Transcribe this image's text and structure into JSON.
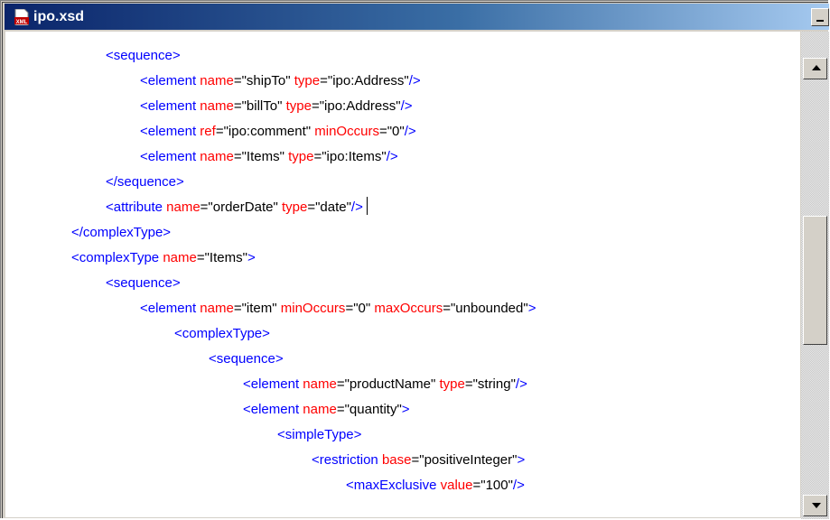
{
  "window": {
    "title": "ipo.xsd",
    "icon": "xml-file-icon",
    "icon_text": "XML",
    "colors": {
      "titlebar_start": "#0a246a",
      "titlebar_end": "#a6caf0",
      "tag": "#0000ff",
      "attribute": "#ff0000",
      "value": "#000000"
    }
  },
  "code": {
    "lines": [
      {
        "indent": 3,
        "parts": [
          [
            "t",
            "<sequence>"
          ]
        ]
      },
      {
        "indent": 4,
        "parts": [
          [
            "t",
            "<element "
          ],
          [
            "a",
            "name"
          ],
          [
            "v",
            "=\"shipTo\" "
          ],
          [
            "a",
            "type"
          ],
          [
            "v",
            "=\"ipo:Address\""
          ],
          [
            "t",
            "/>"
          ]
        ]
      },
      {
        "indent": 4,
        "parts": [
          [
            "t",
            "<element "
          ],
          [
            "a",
            "name"
          ],
          [
            "v",
            "=\"billTo\" "
          ],
          [
            "a",
            "type"
          ],
          [
            "v",
            "=\"ipo:Address\""
          ],
          [
            "t",
            "/>"
          ]
        ]
      },
      {
        "indent": 4,
        "parts": [
          [
            "t",
            "<element "
          ],
          [
            "a",
            "ref"
          ],
          [
            "v",
            "=\"ipo:comment\" "
          ],
          [
            "a",
            "minOccurs"
          ],
          [
            "v",
            "=\"0\""
          ],
          [
            "t",
            "/>"
          ]
        ]
      },
      {
        "indent": 4,
        "parts": [
          [
            "t",
            "<element "
          ],
          [
            "a",
            "name"
          ],
          [
            "v",
            "=\"Items\" "
          ],
          [
            "a",
            "type"
          ],
          [
            "v",
            "=\"ipo:Items\""
          ],
          [
            "t",
            "/>"
          ]
        ]
      },
      {
        "indent": 3,
        "parts": [
          [
            "t",
            "</sequence>"
          ]
        ]
      },
      {
        "indent": 3,
        "parts": [
          [
            "t",
            "<attribute "
          ],
          [
            "a",
            "name"
          ],
          [
            "v",
            "=\"orderDate\" "
          ],
          [
            "a",
            "type"
          ],
          [
            "v",
            "=\"date\""
          ],
          [
            "t",
            "/>"
          ]
        ],
        "caret": true
      },
      {
        "indent": 2,
        "parts": [
          [
            "t",
            "</complexType>"
          ]
        ]
      },
      {
        "indent": 2,
        "parts": [
          [
            "t",
            "<complexType "
          ],
          [
            "a",
            "name"
          ],
          [
            "v",
            "=\"Items\""
          ],
          [
            "t",
            ">"
          ]
        ]
      },
      {
        "indent": 3,
        "parts": [
          [
            "t",
            "<sequence>"
          ]
        ]
      },
      {
        "indent": 4,
        "parts": [
          [
            "t",
            "<element "
          ],
          [
            "a",
            "name"
          ],
          [
            "v",
            "=\"item\" "
          ],
          [
            "a",
            "minOccurs"
          ],
          [
            "v",
            "=\"0\" "
          ],
          [
            "a",
            "maxOccurs"
          ],
          [
            "v",
            "=\"unbounded\""
          ],
          [
            "t",
            ">"
          ]
        ]
      },
      {
        "indent": 5,
        "parts": [
          [
            "t",
            "<complexType>"
          ]
        ]
      },
      {
        "indent": 6,
        "parts": [
          [
            "t",
            "<sequence>"
          ]
        ]
      },
      {
        "indent": 7,
        "parts": [
          [
            "t",
            "<element "
          ],
          [
            "a",
            "name"
          ],
          [
            "v",
            "=\"productName\" "
          ],
          [
            "a",
            "type"
          ],
          [
            "v",
            "=\"string\""
          ],
          [
            "t",
            "/>"
          ]
        ]
      },
      {
        "indent": 7,
        "parts": [
          [
            "t",
            "<element "
          ],
          [
            "a",
            "name"
          ],
          [
            "v",
            "=\"quantity\""
          ],
          [
            "t",
            ">"
          ]
        ]
      },
      {
        "indent": 8,
        "parts": [
          [
            "t",
            "<simpleType>"
          ]
        ]
      },
      {
        "indent": 9,
        "parts": [
          [
            "t",
            "<restriction "
          ],
          [
            "a",
            "base"
          ],
          [
            "v",
            "=\"positiveInteger\""
          ],
          [
            "t",
            ">"
          ]
        ]
      },
      {
        "indent": 10,
        "parts": [
          [
            "t",
            "<maxExclusive "
          ],
          [
            "a",
            "value"
          ],
          [
            "v",
            "=\"100\""
          ],
          [
            "t",
            "/>"
          ]
        ]
      }
    ]
  },
  "scrollbar": {
    "up_icon": "arrow-up-icon",
    "down_icon": "arrow-down-icon"
  }
}
